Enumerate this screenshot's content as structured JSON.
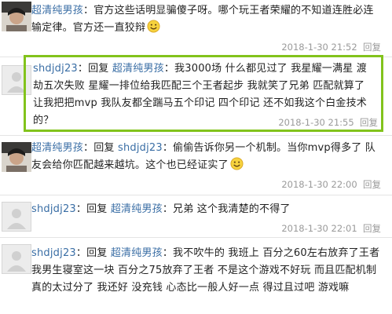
{
  "comments": [
    {
      "user": "超清纯男孩",
      "separator": "：",
      "text": "官方这些话明显骗傻子呀。哪个玩王者荣耀的不知道连胜必连输定律。官方还一直狡辩",
      "has_emoji": true,
      "date": "2018-1-30",
      "time": "21:52",
      "reply_label": "回复"
    },
    {
      "user": "shdjdj23",
      "separator": "：",
      "reply_prefix": "回复",
      "reply_to": "超清纯男孩",
      "text": "：我3000场 什么都见过了 我星耀一满星 渡劫五次失败 星耀一排位给我匹配三个王者起步 我就笑了兄弟 匹配就算了 让我把把mvp 我队友都全踹马五个印记 四个印记 还不如我这个白金技术的？",
      "date": "2018-1-30",
      "time": "21:55",
      "reply_label": "回复"
    },
    {
      "user": "超清纯男孩",
      "separator": "：",
      "reply_prefix": "回复",
      "reply_to": "shdjdj23",
      "text": "：偷偷告诉你另一个机制。当你mvp得多了 队友会给你匹配越来越坑。这个也已经证实了",
      "has_emoji": true,
      "date": "2018-1-30",
      "time": "22:00",
      "reply_label": "回复"
    },
    {
      "user": "shdjdj23",
      "separator": "：",
      "reply_prefix": "回复",
      "reply_to": "超清纯男孩",
      "text": "：兄弟 这个我清楚的不得了",
      "date": "2018-1-30",
      "time": "22:01",
      "reply_label": "回复"
    },
    {
      "user": "shdjdj23",
      "separator": "：",
      "reply_prefix": "回复",
      "reply_to": "超清纯男孩",
      "text": "：我不吹牛的 我班上 百分之60左右放弃了王者 我男生寝室这一块 百分之75放弃了王者 不是这个游戏不好玩 而且匹配机制真的太过分了 我还好 没充钱 心态比一般人好一点 得过且过吧 游戏嘛",
      "date": "",
      "time": "",
      "reply_label": ""
    }
  ],
  "colors": {
    "username": "#3a6ea5",
    "text": "#222222",
    "meta": "#9a9a9a",
    "highlight": "#82c31c"
  }
}
